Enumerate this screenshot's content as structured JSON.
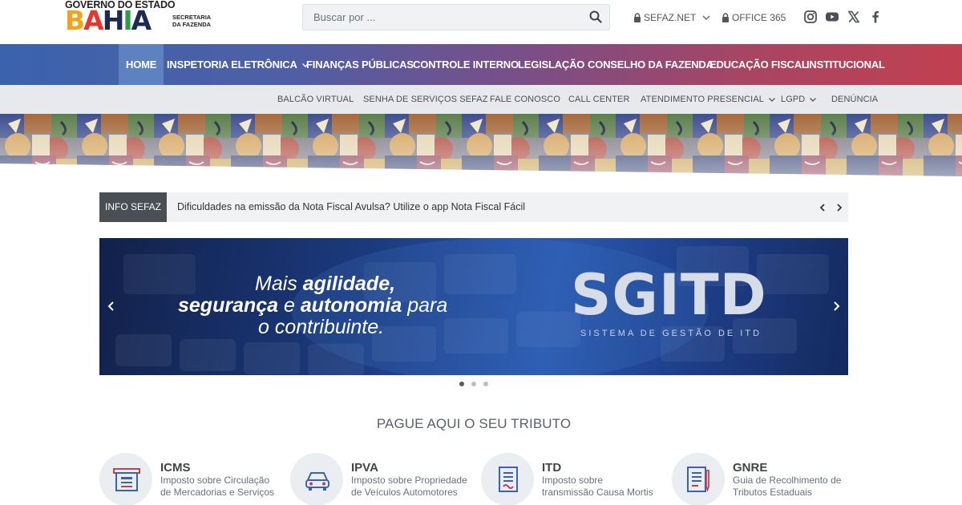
{
  "header": {
    "logo": {
      "top_text": "GOVERNO DO ESTADO",
      "bahia_letters": [
        "B",
        "A",
        "H",
        "I",
        "A"
      ],
      "bahia_colors": [
        "#f2a21b",
        "#e8362f",
        "#1c2a55",
        "#2f9b48",
        "#1c2a55"
      ],
      "secretaria_line1": "SECRETARIA",
      "secretaria_line2": "DA FAZENDA"
    },
    "search": {
      "placeholder": "Buscar por ...",
      "value": "",
      "icon": "search-icon"
    },
    "links": [
      {
        "label": "SEFAZ.NET",
        "icon": "lock-icon",
        "has_dropdown": true
      },
      {
        "label": "OFFICE 365",
        "icon": "lock-icon",
        "has_dropdown": false
      }
    ],
    "social": [
      "instagram-icon",
      "youtube-icon",
      "x-icon",
      "facebook-icon"
    ]
  },
  "main_nav": [
    {
      "label": "HOME",
      "active": true
    },
    {
      "label": "INSPETORIA ELETRÔNICA",
      "has_dropdown": true
    },
    {
      "label": "FINANÇAS PÚBLICAS"
    },
    {
      "label": "CONTROLE INTERNO"
    },
    {
      "label": "LEGISLAÇÃO"
    },
    {
      "label": "CONSELHO DA FAZENDA"
    },
    {
      "label": "EDUCAÇÃO FISCAL"
    },
    {
      "label": "INSTITUCIONAL"
    }
  ],
  "sub_nav": [
    {
      "label": "BALCÃO VIRTUAL"
    },
    {
      "label": "SENHA DE SERVIÇOS SEFAZ"
    },
    {
      "label": "FALE CONOSCO"
    },
    {
      "label": "CALL CENTER"
    },
    {
      "label": "ATENDIMENTO PRESENCIAL",
      "has_dropdown": true
    },
    {
      "label": "LGPD",
      "has_dropdown": true
    },
    {
      "label": "DENÚNCIA"
    }
  ],
  "info_bar": {
    "label": "INFO SEFAZ",
    "message": "Dificuldades na emissão da Nota Fiscal Avulsa? Utilize o app Nota Fiscal Fácil"
  },
  "carousel": {
    "slide": {
      "line1_plain": "Mais ",
      "line1_bold": "agilidade,",
      "line2_bold": "segurança",
      "line2_plain": " e ",
      "line2_bold2": "autonomia",
      "line2_plain2": " para",
      "line3_plain": "o contribuinte.",
      "brand": "SGITD",
      "brand_sub": "SISTEMA DE GESTÃO DE ITD"
    },
    "slide_count": 3,
    "active_index": 0
  },
  "pay_section": {
    "title": "PAGUE AQUI O SEU TRIBUTO",
    "cards": [
      {
        "title": "ICMS",
        "desc1": "Imposto sobre Circulação",
        "desc2": "de Mercadorias e Serviços",
        "icon": "register-icon"
      },
      {
        "title": "IPVA",
        "desc1": "Imposto sobre Propriedade",
        "desc2": "de Veículos Automotores",
        "icon": "car-icon"
      },
      {
        "title": "ITD",
        "desc1": "Imposto sobre",
        "desc2": "transmissão Causa Mortis",
        "icon": "document-icon"
      },
      {
        "title": "GNRE",
        "desc1": "Guia de Recolhimento de",
        "desc2": "Tributos Estaduais",
        "icon": "receipt-pen-icon"
      }
    ]
  },
  "colors": {
    "nav_gradient_start": "#3a63ad",
    "nav_gradient_end": "#c2404f",
    "active_nav": "#5e82c0",
    "info_label_bg": "#4a4f55",
    "subnav_bg": "#e7e9ec"
  }
}
